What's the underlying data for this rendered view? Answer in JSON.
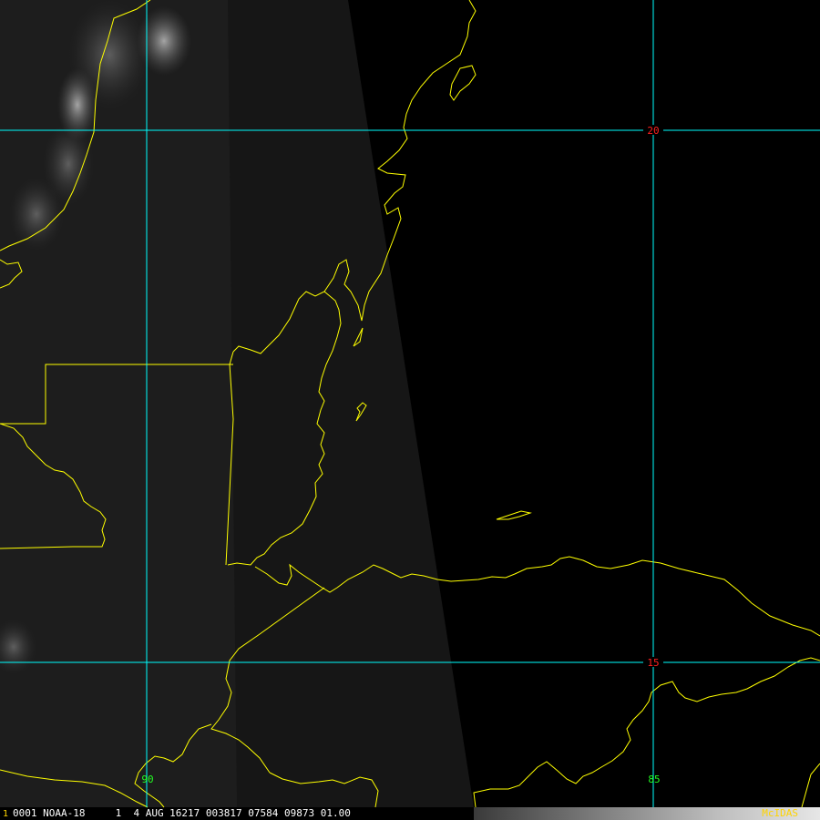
{
  "colors": {
    "background": "#000000",
    "coastline": "#ffff00",
    "grid": "#00ffff",
    "lat_label": "#ff2020",
    "lon_label": "#22ff22",
    "brand": "#ffd400"
  },
  "grid": {
    "lat_labels": [
      "20",
      "15"
    ],
    "lon_labels": [
      "90",
      "85"
    ]
  },
  "status_bar": {
    "frame_number": "1",
    "text": "0001 NOAA-18     1  4 AUG 16217 003817 07584 09873 01.00",
    "brand": "McIDAS"
  }
}
